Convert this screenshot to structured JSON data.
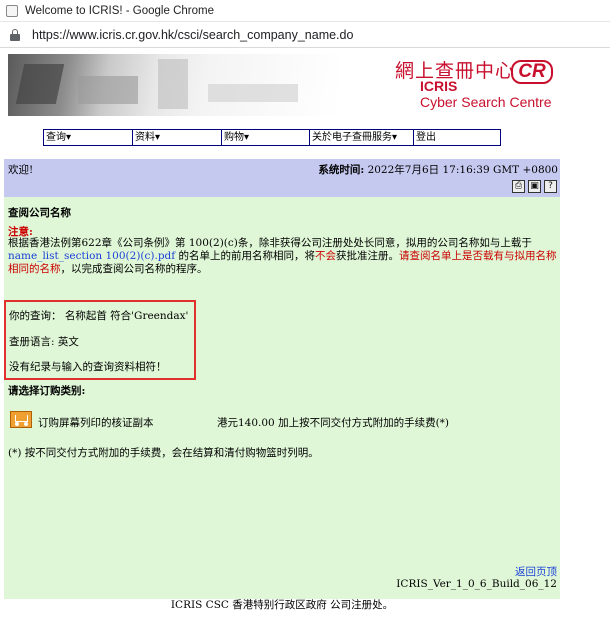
{
  "browser": {
    "window_title": "Welcome to ICRIS! - Google Chrome",
    "url": "https://www.icris.cr.gov.hk/csci/search_company_name.do"
  },
  "banner": {
    "logo_chinese": "網上查冊中心",
    "logo_cr": "CR",
    "logo_icris": "ICRIS",
    "logo_subtitle": "Cyber Search Centre"
  },
  "menu": {
    "items": [
      {
        "label": "查询▾"
      },
      {
        "label": "资料▾"
      },
      {
        "label": "购物▾"
      },
      {
        "label": "关於电子查冊服务▾"
      },
      {
        "label": "登出"
      }
    ]
  },
  "header": {
    "welcome": "欢迎!",
    "system_time_label": "系统时间:",
    "system_time_value": " 2022年7月6日 17:16:39 GMT +0800",
    "icons": [
      "printer-icon",
      "save-icon",
      "help-icon"
    ]
  },
  "main": {
    "heading": "查阅公司名称",
    "note_title": "注意:",
    "note_text_1": "根据香港法例第622章《公司条例》第 100(2)(c)条，除非获得公司注册处处长同意，拟用的公司名称如与上载于 ",
    "note_link": "name_list_section 100(2)(c).pdf",
    "note_text_2": " 的名单上的前用名称相同，将",
    "note_not": "不会",
    "note_text_3": "获批准注册。",
    "note_red": "请查阅名单上是否载有与拟用名称相同的名称",
    "note_text_4": "，以完成查阅公司名称的程序。",
    "query_label": "你的查询：  名称起首 符合'Greendax'",
    "language_label": "查册语言: 英文",
    "no_record": "没有纪录与输入的查询资料相符！"
  },
  "order": {
    "title": "请选择订购类别:",
    "item_label": "订购屏幕列印的核证副本",
    "item_price": "港元140.00 加上按不同交付方式附加的手续费(*)",
    "footnote": "(*) 按不同交付方式附加的手续费，会在结算和清付购物篮时列明。"
  },
  "footer": {
    "back_link": "返回页顶",
    "version": "ICRIS_Ver_1_0_6_Build_06_12",
    "copyright": "ICRIS CSC 香港特别行政区政府 公司注册处。"
  },
  "colors": {
    "header_bg": "#c5c9f0",
    "content_bg": "#dff7d7",
    "accent_red": "#cc0000",
    "link_blue": "#1a3fd8"
  }
}
